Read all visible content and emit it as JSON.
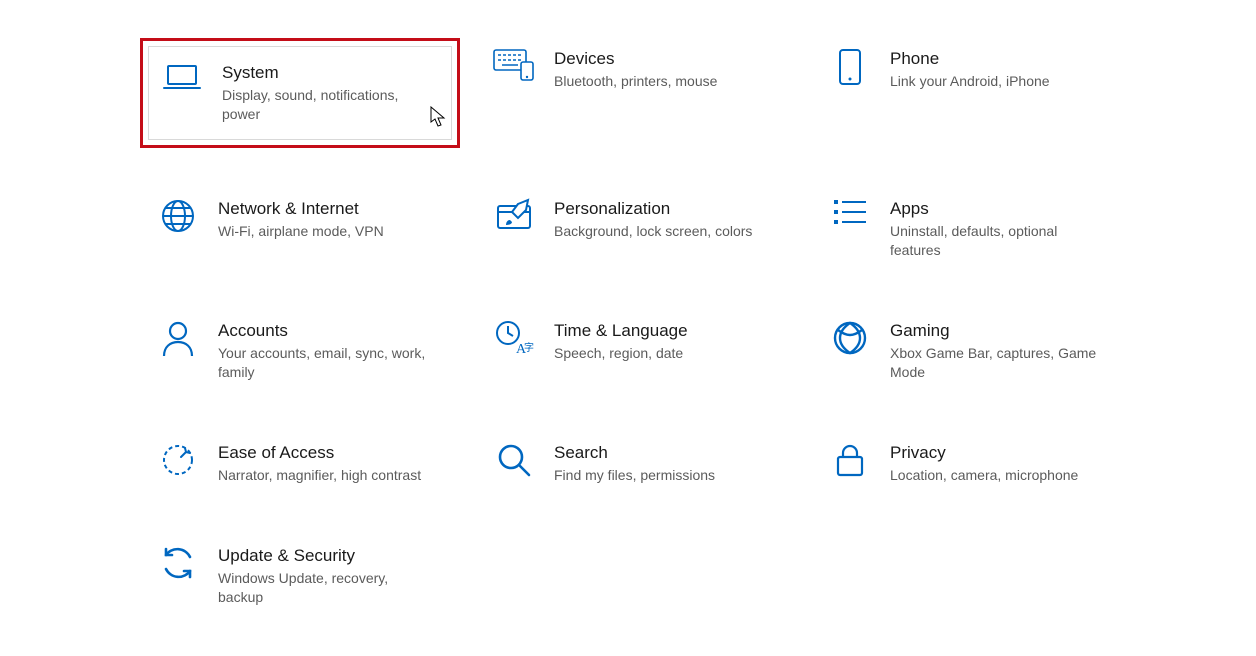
{
  "accent": "#0067c0",
  "categories": [
    {
      "id": "system",
      "icon": "laptop",
      "title": "System",
      "desc": "Display, sound, notifications, power",
      "selected": true
    },
    {
      "id": "devices",
      "icon": "keyboard",
      "title": "Devices",
      "desc": "Bluetooth, printers, mouse"
    },
    {
      "id": "phone",
      "icon": "phone",
      "title": "Phone",
      "desc": "Link your Android, iPhone"
    },
    {
      "id": "network",
      "icon": "globe",
      "title": "Network & Internet",
      "desc": "Wi-Fi, airplane mode, VPN"
    },
    {
      "id": "personalization",
      "icon": "paintbrush",
      "title": "Personalization",
      "desc": "Background, lock screen, colors"
    },
    {
      "id": "apps",
      "icon": "apps-list",
      "title": "Apps",
      "desc": "Uninstall, defaults, optional features"
    },
    {
      "id": "accounts",
      "icon": "person",
      "title": "Accounts",
      "desc": "Your accounts, email, sync, work, family"
    },
    {
      "id": "time-language",
      "icon": "time-lang",
      "title": "Time & Language",
      "desc": "Speech, region, date"
    },
    {
      "id": "gaming",
      "icon": "gaming",
      "title": "Gaming",
      "desc": "Xbox Game Bar, captures, Game Mode"
    },
    {
      "id": "ease-of-access",
      "icon": "ease",
      "title": "Ease of Access",
      "desc": "Narrator, magnifier, high contrast"
    },
    {
      "id": "search",
      "icon": "search",
      "title": "Search",
      "desc": "Find my files, permissions"
    },
    {
      "id": "privacy",
      "icon": "lock",
      "title": "Privacy",
      "desc": "Location, camera, microphone"
    },
    {
      "id": "update-security",
      "icon": "sync",
      "title": "Update & Security",
      "desc": "Windows Update, recovery, backup"
    }
  ]
}
